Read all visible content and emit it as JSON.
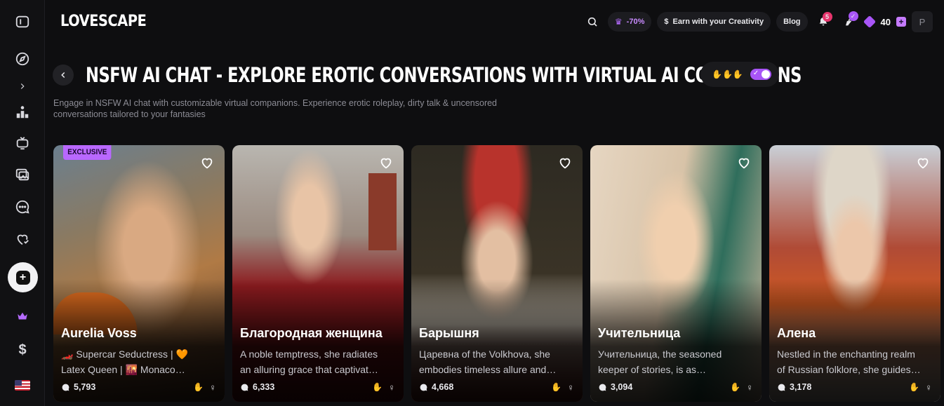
{
  "app": {
    "logo": "LOVESCAPE"
  },
  "header": {
    "discount": "-70%",
    "earn_label": "Earn with your Creativity",
    "blog_label": "Blog",
    "notifications_count": "5",
    "gems_count": "40",
    "avatar_letter": "P"
  },
  "page": {
    "title": "NSFW AI CHAT - EXPLORE EROTIC CONVERSATIONS WITH VIRTUAL AI COMPANIONS",
    "subtitle": "Engage in NSFW AI chat with customizable virtual companions. Experience erotic roleplay, dirty talk & uncensored conversations tailored to your fantasies"
  },
  "cards": [
    {
      "name": "Aurelia Voss",
      "badge": "EXCLUSIVE",
      "desc1": "🏎️ Supercar Seductress | 🧡",
      "desc2": "Latex Queen | 🌇 Monaco…",
      "chats": "5,793"
    },
    {
      "name": "Благородная женщина",
      "badge": "",
      "desc1": "A noble temptress, she radiates",
      "desc2": "an alluring grace that captivat…",
      "chats": "6,333"
    },
    {
      "name": "Барышня",
      "badge": "",
      "desc1": "Царевна of the Volkhova, she",
      "desc2": "embodies timeless allure and…",
      "chats": "4,668"
    },
    {
      "name": "Учительница",
      "badge": "",
      "desc1": "Учительница, the seasoned",
      "desc2": "keeper of stories, is as…",
      "chats": "3,094"
    },
    {
      "name": "Алена",
      "badge": "",
      "desc1": "Nestled in the enchanting realm",
      "desc2": "of Russian folklore, she guides…",
      "chats": "3,178"
    }
  ],
  "colors": {
    "accent": "#a855f7",
    "badge": "#b968ff",
    "notification": "#e8356d"
  },
  "icons": {
    "sidebar": [
      "sidebar-toggle-icon",
      "compass-icon",
      "chevron-right-icon",
      "leaderboard-icon",
      "tv-icon",
      "gallery-icon",
      "chat-icon",
      "heart-refresh-icon",
      "plus-icon",
      "crown-icon",
      "dollar-icon",
      "us-flag-icon"
    ]
  }
}
